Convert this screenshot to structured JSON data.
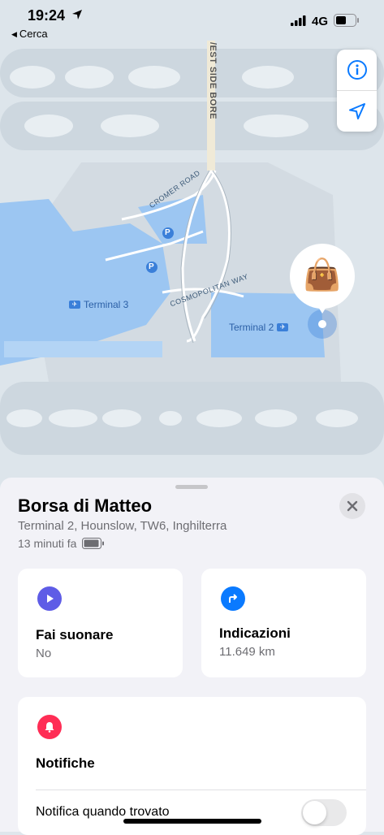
{
  "status_bar": {
    "time": "19:24",
    "back_label": "Cerca",
    "network": "4G"
  },
  "map": {
    "road_labels": [
      "/EST SIDE BORE",
      "CROMER ROAD",
      "COSMOPOLITAN WAY"
    ],
    "terminals": [
      "Terminal 3",
      "Terminal 2"
    ],
    "parking_symbol": "P",
    "pin_icon": "handbag-emoji",
    "pin_emoji": "👜"
  },
  "map_controls": {
    "info_icon": "info-icon",
    "locate_icon": "location-arrow-icon"
  },
  "item": {
    "name": "Borsa di Matteo",
    "address": "Terminal 2, Hounslow, TW6, Inghilterra",
    "last_seen": "13 minuti fa"
  },
  "actions": {
    "sound": {
      "title": "Fai suonare",
      "subtitle": "No",
      "icon": "play-icon",
      "color": "#5e5ce6"
    },
    "directions": {
      "title": "Indicazioni",
      "subtitle": "11.649 km",
      "icon": "turn-right-arrow-icon",
      "color": "#0a7aff"
    }
  },
  "notifications": {
    "title": "Notifiche",
    "icon": "bell-icon",
    "color": "#ff2d55",
    "toggle_label": "Notifica quando trovato",
    "toggle_on": false
  },
  "colors": {
    "accent": "#0a7aff",
    "terminal_blue": "#9cc6f2"
  }
}
